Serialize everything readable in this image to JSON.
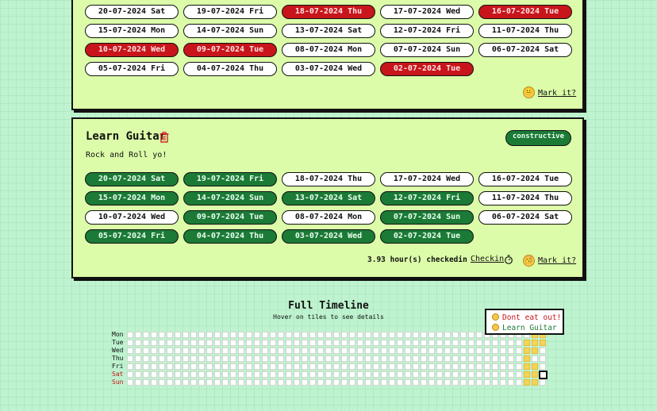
{
  "habit1": {
    "dates": [
      {
        "label": "20-07-2024 Sat",
        "state": "none"
      },
      {
        "label": "19-07-2024 Fri",
        "state": "none"
      },
      {
        "label": "18-07-2024 Thu",
        "state": "red"
      },
      {
        "label": "17-07-2024 Wed",
        "state": "none"
      },
      {
        "label": "16-07-2024 Tue",
        "state": "red"
      },
      {
        "label": "15-07-2024 Mon",
        "state": "none"
      },
      {
        "label": "14-07-2024 Sun",
        "state": "none"
      },
      {
        "label": "13-07-2024 Sat",
        "state": "none"
      },
      {
        "label": "12-07-2024 Fri",
        "state": "none"
      },
      {
        "label": "11-07-2024 Thu",
        "state": "none"
      },
      {
        "label": "10-07-2024 Wed",
        "state": "red"
      },
      {
        "label": "09-07-2024 Tue",
        "state": "red"
      },
      {
        "label": "08-07-2024 Mon",
        "state": "none"
      },
      {
        "label": "07-07-2024 Sun",
        "state": "none"
      },
      {
        "label": "06-07-2024 Sat",
        "state": "none"
      },
      {
        "label": "05-07-2024 Fri",
        "state": "none"
      },
      {
        "label": "04-07-2024 Thu",
        "state": "none"
      },
      {
        "label": "03-07-2024 Wed",
        "state": "none"
      },
      {
        "label": "02-07-2024 Tue",
        "state": "red"
      }
    ],
    "mark_label": "Mark it?",
    "mark_icon": "neutral-face-icon"
  },
  "habit2": {
    "title": "Learn Guitar",
    "description": "Rock and Roll yo!",
    "tag": "constructive",
    "dates": [
      {
        "label": "20-07-2024 Sat",
        "state": "green"
      },
      {
        "label": "19-07-2024 Fri",
        "state": "green"
      },
      {
        "label": "18-07-2024 Thu",
        "state": "none"
      },
      {
        "label": "17-07-2024 Wed",
        "state": "none"
      },
      {
        "label": "16-07-2024 Tue",
        "state": "none"
      },
      {
        "label": "15-07-2024 Mon",
        "state": "green"
      },
      {
        "label": "14-07-2024 Sun",
        "state": "green"
      },
      {
        "label": "13-07-2024 Sat",
        "state": "green"
      },
      {
        "label": "12-07-2024 Fri",
        "state": "green"
      },
      {
        "label": "11-07-2024 Thu",
        "state": "none"
      },
      {
        "label": "10-07-2024 Wed",
        "state": "none"
      },
      {
        "label": "09-07-2024 Tue",
        "state": "green"
      },
      {
        "label": "08-07-2024 Mon",
        "state": "none"
      },
      {
        "label": "07-07-2024 Sun",
        "state": "green"
      },
      {
        "label": "06-07-2024 Sat",
        "state": "none"
      },
      {
        "label": "05-07-2024 Fri",
        "state": "green"
      },
      {
        "label": "04-07-2024 Thu",
        "state": "green"
      },
      {
        "label": "03-07-2024 Wed",
        "state": "green"
      },
      {
        "label": "02-07-2024 Tue",
        "state": "green"
      }
    ],
    "hours_text": "3.93 hour(s) checkedin",
    "checkin_label": "Checkin",
    "mark_label": "Mark it?",
    "mark_icon": "party-face-icon"
  },
  "timeline": {
    "title": "Full Timeline",
    "subtitle": "Hover on tiles to see details",
    "days": [
      "Mon",
      "Tue",
      "Wed",
      "Thu",
      "Fri",
      "Sat",
      "Sun"
    ],
    "weeks": 53,
    "filled": [
      [
        50,
        1
      ],
      [
        50,
        2
      ],
      [
        50,
        3
      ],
      [
        50,
        4
      ],
      [
        50,
        5
      ],
      [
        50,
        6
      ],
      [
        51,
        0
      ],
      [
        51,
        1
      ],
      [
        51,
        2
      ],
      [
        51,
        4
      ],
      [
        51,
        5
      ],
      [
        51,
        6
      ],
      [
        52,
        0
      ],
      [
        52,
        1
      ]
    ],
    "selected": [
      52,
      5
    ],
    "legend": [
      {
        "label": "Dont eat out!",
        "color": "#c8151b"
      },
      {
        "label": "Learn Guitar",
        "color": "#1b7a36"
      }
    ]
  },
  "colors": {
    "red": "#c8151b",
    "green": "#1b7a36",
    "card_bg": "#dcfca9",
    "heat": "#f6d35a"
  }
}
